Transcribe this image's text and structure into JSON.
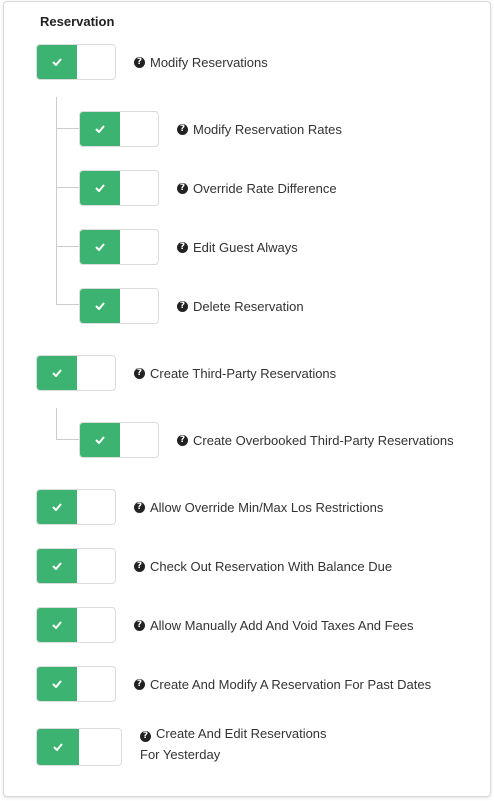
{
  "section": {
    "title": "Reservation"
  },
  "permissions": {
    "modify_reservations": "Modify Reservations",
    "modify_reservation_rates": "Modify Reservation Rates",
    "override_rate_difference": "Override Rate Difference",
    "edit_guest_always": "Edit Guest Always",
    "delete_reservation": "Delete Reservation",
    "create_third_party": "Create Third-Party Reservations",
    "create_overbooked_third_party": "Create Overbooked Third-Party Reservations",
    "allow_override_minmax_los": "Allow Override Min/Max Los Restrictions",
    "check_out_with_balance_due": "Check Out Reservation With Balance Due",
    "allow_manually_add_void_taxes": "Allow Manually Add And Void Taxes And Fees",
    "create_modify_past_dates": "Create And Modify A Reservation For Past Dates",
    "create_edit_yesterday_line1": "Create And Edit Reservations",
    "create_edit_yesterday_line2": "For Yesterday"
  },
  "icons": {
    "toggle_on": "check-icon",
    "help": "question-circle-icon"
  },
  "colors": {
    "toggle_on": "#3cb371",
    "border": "#dcdcdc"
  },
  "state": {
    "modify_reservations": true,
    "modify_reservation_rates": true,
    "override_rate_difference": true,
    "edit_guest_always": true,
    "delete_reservation": true,
    "create_third_party": true,
    "create_overbooked_third_party": true,
    "allow_override_minmax_los": true,
    "check_out_with_balance_due": true,
    "allow_manually_add_void_taxes": true,
    "create_modify_past_dates": true,
    "create_edit_yesterday": true
  }
}
